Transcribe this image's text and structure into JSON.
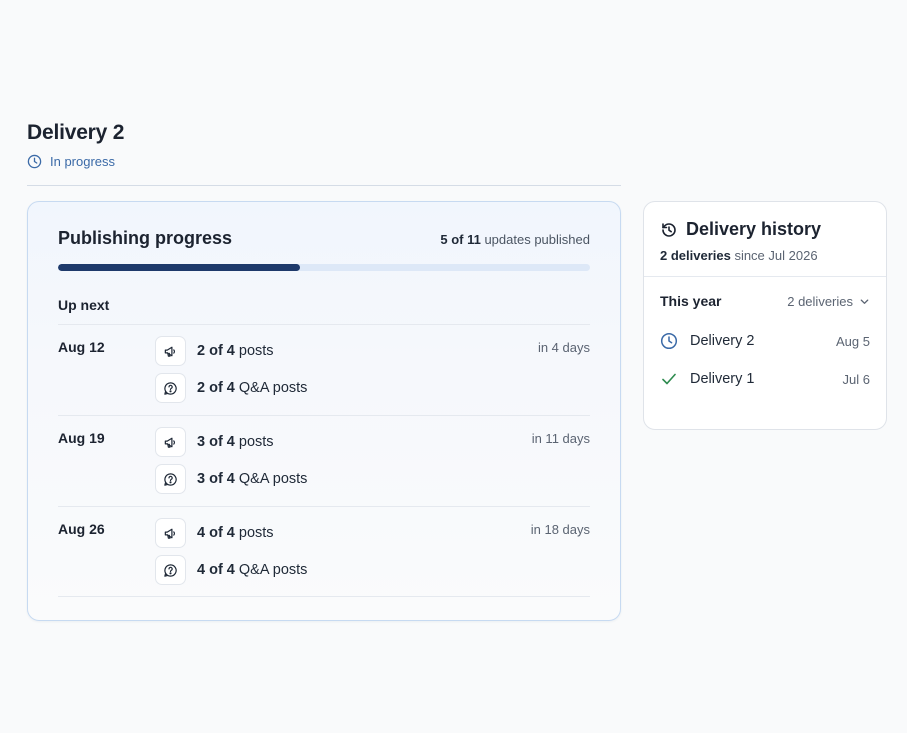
{
  "delivery": {
    "title": "Delivery 2",
    "status": "In progress",
    "status_icon": "clock-icon",
    "accent_color": "#3b6aa7"
  },
  "progress": {
    "title": "Publishing progress",
    "published_count": "5 of 11",
    "published_suffix": " updates published",
    "published_fraction": 0.4545,
    "up_next_label": "Up next",
    "rows": [
      {
        "date": "Aug 12",
        "relative": "in 4 days",
        "posts_count": "2 of 4",
        "posts_label": " posts",
        "qa_count": "2 of 4",
        "qa_label": " Q&A posts"
      },
      {
        "date": "Aug 19",
        "relative": "in 11 days",
        "posts_count": "3 of 4",
        "posts_label": " posts",
        "qa_count": "3 of 4",
        "qa_label": " Q&A posts"
      },
      {
        "date": "Aug 26",
        "relative": "in 18 days",
        "posts_count": "4 of 4",
        "posts_label": " posts",
        "qa_count": "4 of 4",
        "qa_label": " Q&A posts"
      }
    ],
    "icons": {
      "posts": "megaphone-icon",
      "qa": "question-bubble-icon"
    }
  },
  "history": {
    "title": "Delivery history",
    "icon": "history-icon",
    "summary_count": "2 deliveries",
    "summary_suffix": " since Jul 2026",
    "period_label": "This year",
    "period_count": "2 deliveries",
    "items": [
      {
        "name": "Delivery 2",
        "date": "Aug 5",
        "icon": "clock-icon"
      },
      {
        "name": "Delivery 1",
        "date": "Jul 6",
        "icon": "check-icon"
      }
    ]
  }
}
